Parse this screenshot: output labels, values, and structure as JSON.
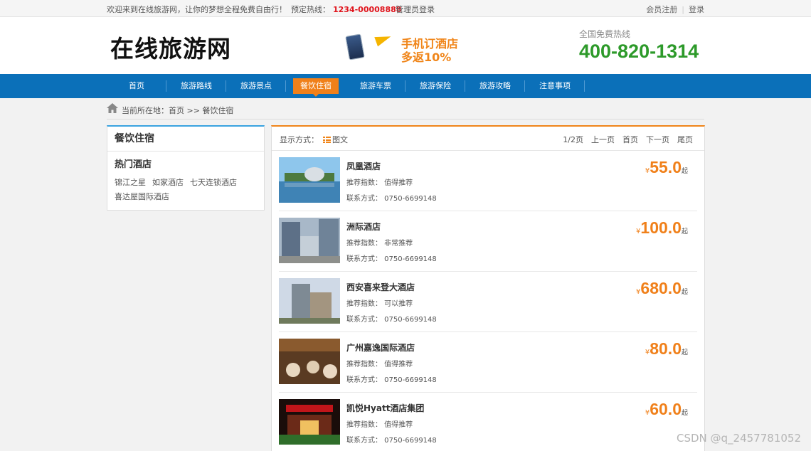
{
  "topbar": {
    "welcome": "欢迎来到在线旅游网，让你的梦想全程免费自由行！",
    "hotline_label": "预定热线：",
    "hotline_number": "1234-00008888",
    "admin_login": "管理员登录",
    "register": "会员注册",
    "separator": "|",
    "login": "登录"
  },
  "header": {
    "logo": "在线旅游网",
    "promo_line1": "手机订酒店",
    "promo_line2": "多返10%",
    "free_hotline_label": "全国免费热线",
    "free_hotline_number": "400-820-1314"
  },
  "nav": {
    "items": [
      {
        "label": "首页"
      },
      {
        "label": "旅游路线"
      },
      {
        "label": "旅游景点"
      },
      {
        "label": "餐饮住宿"
      },
      {
        "label": "旅游车票"
      },
      {
        "label": "旅游保险"
      },
      {
        "label": "旅游攻略"
      },
      {
        "label": "注意事项"
      }
    ],
    "active_index": 3
  },
  "breadcrumb": {
    "text": "当前所在地：首页 >> 餐饮住宿"
  },
  "sidebar": {
    "title": "餐饮住宿",
    "subtitle": "热门酒店",
    "links": [
      "锦江之星",
      "如家酒店",
      "七天连锁酒店",
      "喜达屋国际酒店"
    ]
  },
  "toolbar": {
    "mode_label": "显示方式：",
    "mode_value": "图文",
    "page_info": "1/2页",
    "prev": "上一页",
    "first": "首页",
    "next": "下一页",
    "last": "尾页"
  },
  "hotels": [
    {
      "name": "凤凰酒店",
      "rec": "推荐指数：  值得推荐",
      "contact": "联系方式：  0750-6699148",
      "yen": "¥",
      "price": "55.0",
      "suffix": "起"
    },
    {
      "name": "洲际酒店",
      "rec": "推荐指数：  非常推荐",
      "contact": "联系方式：  0750-6699148",
      "yen": "¥",
      "price": "100.0",
      "suffix": "起"
    },
    {
      "name": "西安喜来登大酒店",
      "rec": "推荐指数：  可以推荐",
      "contact": "联系方式：  0750-6699148",
      "yen": "¥",
      "price": "680.0",
      "suffix": "起"
    },
    {
      "name": "广州嘉逸国际酒店",
      "rec": "推荐指数：  值得推荐",
      "contact": "联系方式：  0750-6699148",
      "yen": "¥",
      "price": "80.0",
      "suffix": "起"
    },
    {
      "name": "凯悦Hyatt酒店集团",
      "rec": "推荐指数：  值得推荐",
      "contact": "联系方式：  0750-6699148",
      "yen": "¥",
      "price": "60.0",
      "suffix": "起"
    }
  ],
  "watermark": "CSDN @q_2457781052",
  "colors": {
    "nav_blue": "#0b70b9",
    "accent_orange": "#f0801a",
    "hotline_red": "#e0141c",
    "hotline_green": "#2d9a2a",
    "sidebar_top": "#3aa3e0"
  }
}
